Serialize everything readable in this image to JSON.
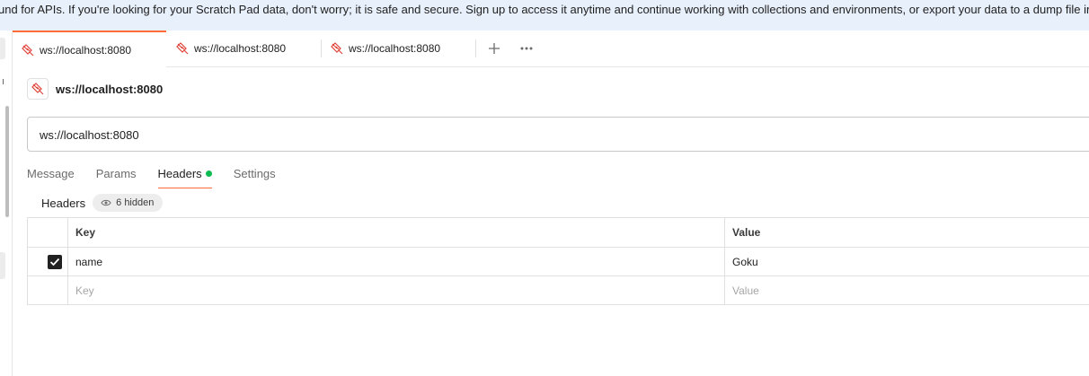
{
  "banner": {
    "text": "und for APIs. If you're looking for your Scratch Pad data, don't worry; it is safe and secure. Sign up to access it anytime and continue working with collections and environments, or export your data to a dump file in Se"
  },
  "tabs": [
    {
      "label": "ws://localhost:8080",
      "active": true
    },
    {
      "label": "ws://localhost:8080",
      "active": false
    },
    {
      "label": "ws://localhost:8080",
      "active": false
    }
  ],
  "tab_actions": {
    "new_tab_icon": "plus-icon",
    "more_icon": "ellipsis-icon",
    "new_tab_glyph": "+"
  },
  "request": {
    "name": "ws://localhost:8080",
    "url": "ws://localhost:8080",
    "icon": "websocket-icon"
  },
  "subtabs": [
    {
      "label": "Message",
      "active": false
    },
    {
      "label": "Params",
      "active": false
    },
    {
      "label": "Headers",
      "active": true
    },
    {
      "label": "Settings",
      "active": false
    }
  ],
  "headers_section": {
    "label": "Headers",
    "hidden_count_label": "6 hidden",
    "table": {
      "columns": [
        "Key",
        "Value"
      ],
      "rows": [
        {
          "checked": true,
          "key": "name",
          "value": "Goku"
        }
      ],
      "placeholder": {
        "key": "Key",
        "value": "Value"
      }
    }
  },
  "colors": {
    "accent": "#ff6c37",
    "active_dot": "#0cbb52",
    "banner_bg": "#e8f0fb"
  }
}
